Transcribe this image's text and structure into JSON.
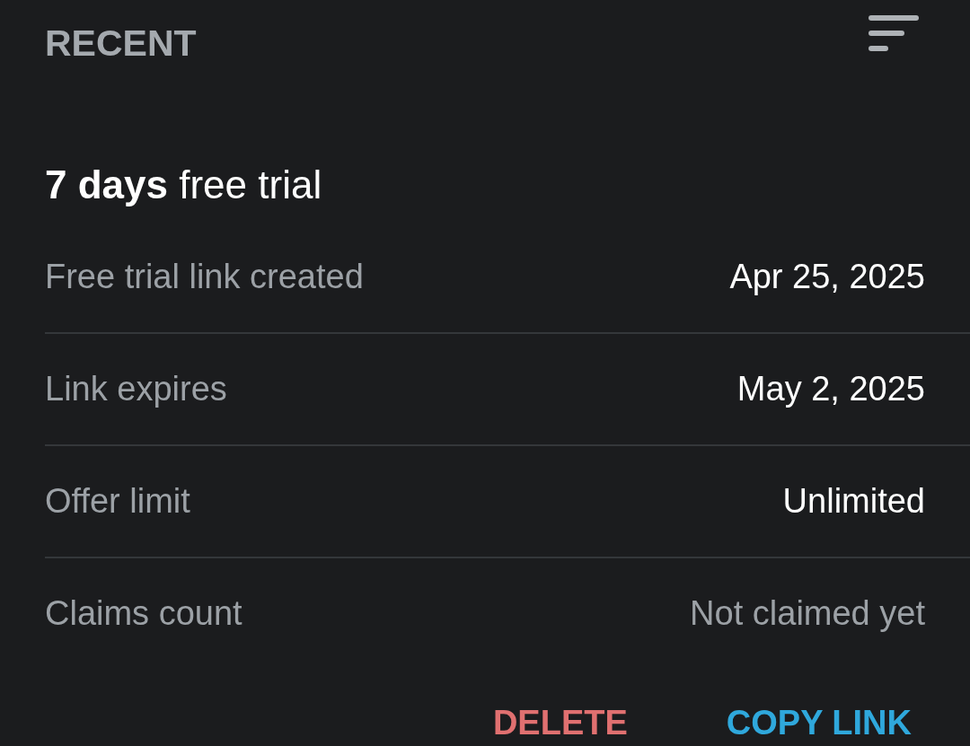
{
  "header": {
    "title": "RECENT"
  },
  "offer": {
    "title": "**7 days** free trial"
  },
  "rows": [
    {
      "label": "Free trial link created",
      "value": "Apr 25, 2025",
      "dimmed": false
    },
    {
      "label": "Link expires",
      "value": "May 2, 2025",
      "dimmed": false
    },
    {
      "label": "Offer limit",
      "value": "Unlimited",
      "dimmed": false
    },
    {
      "label": "Claims count",
      "value": "Not claimed yet",
      "dimmed": true
    }
  ],
  "buttons": [
    {
      "label": "DELETE",
      "kind": "danger"
    },
    {
      "label": "COPY LINK",
      "kind": "primary"
    }
  ]
}
